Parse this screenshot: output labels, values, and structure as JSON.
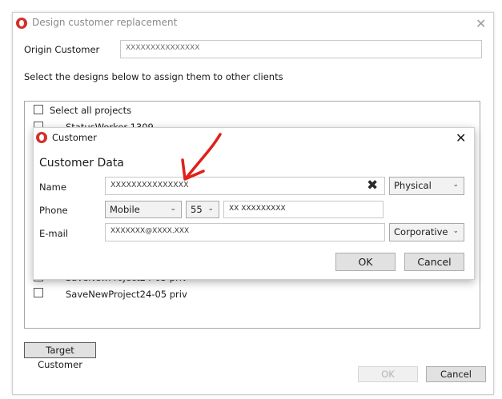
{
  "main_window": {
    "title": "Design customer replacement",
    "origin_label": "Origin Customer",
    "origin_value": "XXXXXXXXXXXXXXX",
    "instruction": "Select the designs below to assign them to other clients",
    "select_all_label": "Select all projects",
    "projects": [
      "StatusWorker-1309",
      "SaveNewProject24-05 priv",
      "SaveNewProject24-05 priv"
    ],
    "target_button": "Target Customer",
    "ok_button": "OK",
    "cancel_button": "Cancel"
  },
  "customer_dialog": {
    "title": "Customer",
    "section_title": "Customer Data",
    "name_label": "Name",
    "name_value": "XXXXXXXXXXXXXXX",
    "name_type": "Physical",
    "phone_label": "Phone",
    "phone_type": "Mobile",
    "phone_country": "55",
    "phone_number": "XX XXXXXXXXX",
    "email_label": "E-mail",
    "email_value": "XXXXXXX@XXXX.XXX",
    "email_type": "Corporative",
    "ok_button": "OK",
    "cancel_button": "Cancel"
  },
  "colors": {
    "annotation_arrow": "#e0201b",
    "app_icon": "#d0312d"
  }
}
